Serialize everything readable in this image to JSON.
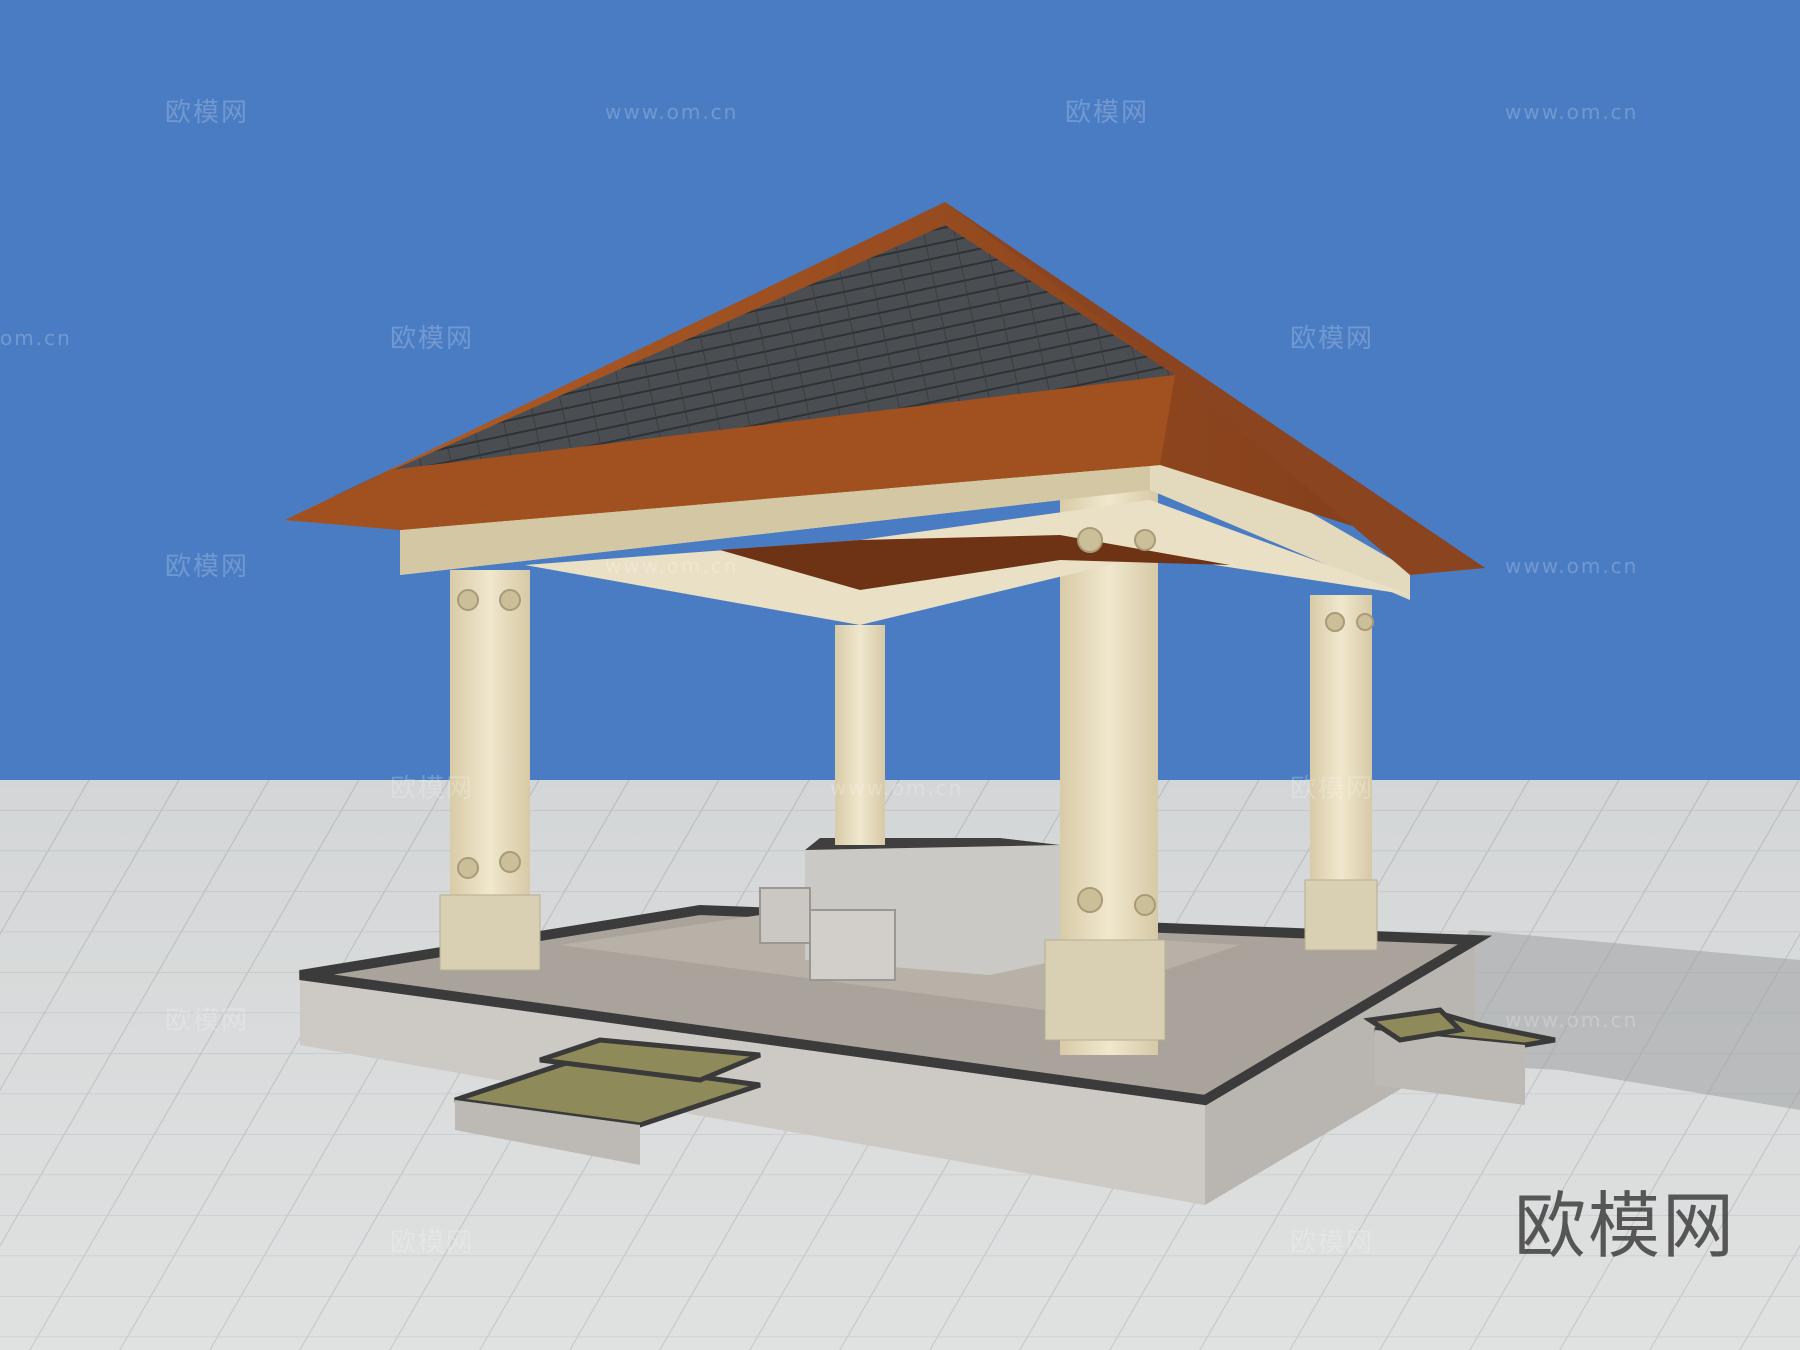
{
  "scene": {
    "subject": "pavilion",
    "colors": {
      "sky": "#4a7cc3",
      "ground": "#d9dcdc",
      "roof_shingle": "#4b4e52",
      "roof_wood": "#9a4d22",
      "column_stone": "#e6dcbf",
      "platform_stone": "#c9c6c1",
      "table_stone": "#c8c6c2"
    }
  },
  "watermarks": {
    "brand": "欧模网",
    "url": "www.om.cn",
    "url_partial": "om.cn"
  },
  "logo": {
    "text": "欧模网"
  }
}
